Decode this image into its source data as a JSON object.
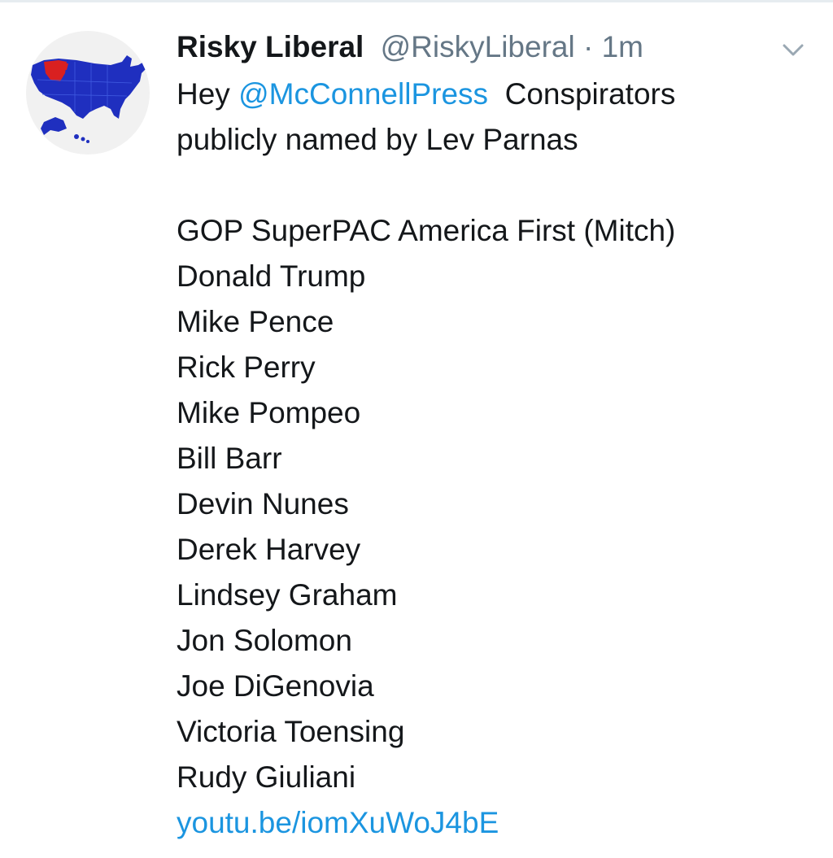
{
  "tweet": {
    "author_name": "Risky Liberal",
    "author_handle": "@RiskyLiberal",
    "separator": "·",
    "timestamp": "1m",
    "text_intro": "Hey",
    "mention": "@McConnellPress",
    "text_after_mention": "Conspirators",
    "text_line2": "publicly named by Lev Parnas",
    "names": [
      "GOP SuperPAC America First (Mitch)",
      "Donald Trump",
      "Mike Pence",
      "Rick Perry",
      "Mike Pompeo",
      "Bill Barr",
      "Devin Nunes",
      "Derek Harvey",
      "Lindsey Graham",
      "Jon Solomon",
      "Joe DiGenovia",
      "Victoria Toensing",
      "Rudy Giuliani"
    ],
    "link": "youtu.be/iomXuWoJ4bE"
  },
  "colors": {
    "text": "#14171a",
    "secondary": "#657786",
    "link": "#1b95e0",
    "avatar_map_blue": "#1f2fbf",
    "avatar_map_red": "#d92020"
  },
  "icons": {
    "avatar": "us-map-avatar-icon",
    "caret": "chevron-down-icon"
  }
}
